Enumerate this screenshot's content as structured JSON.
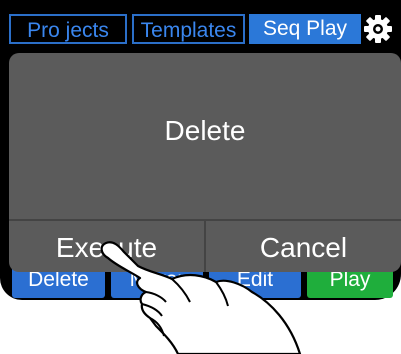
{
  "tabs": [
    {
      "label": "Pro jects"
    },
    {
      "label": "Templates"
    },
    {
      "label": "Seq Play"
    }
  ],
  "settings_icon": "gear-icon",
  "bottom_buttons": [
    {
      "label": "Delete"
    },
    {
      "label": "Mirror"
    },
    {
      "label": "Edit"
    },
    {
      "label": "Play"
    }
  ],
  "dialog": {
    "title": "Delete",
    "execute_label": "Execute",
    "cancel_label": "Cancel"
  },
  "colors": {
    "tab_outline": "#2b6fc9",
    "tab_active": "#2b78d8",
    "button_blue": "#2b6fd2",
    "button_green": "#1fae3c",
    "dialog_bg": "#5b5b5b"
  }
}
